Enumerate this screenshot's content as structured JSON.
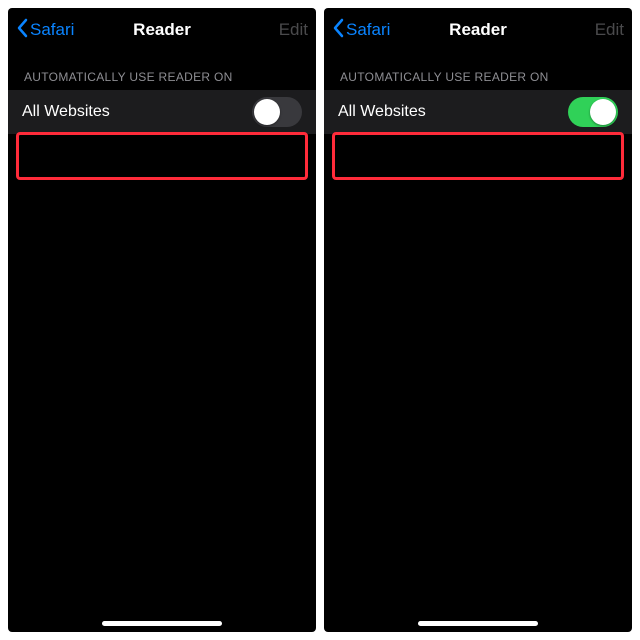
{
  "screens": [
    {
      "nav": {
        "back": "Safari",
        "title": "Reader",
        "edit": "Edit"
      },
      "section_header": "AUTOMATICALLY USE READER ON",
      "row_label": "All Websites",
      "toggle_on": false
    },
    {
      "nav": {
        "back": "Safari",
        "title": "Reader",
        "edit": "Edit"
      },
      "section_header": "AUTOMATICALLY USE READER ON",
      "row_label": "All Websites",
      "toggle_on": true
    }
  ],
  "colors": {
    "accent": "#0a84ff",
    "toggle_on": "#30d158",
    "highlight": "#ff2b3a"
  }
}
